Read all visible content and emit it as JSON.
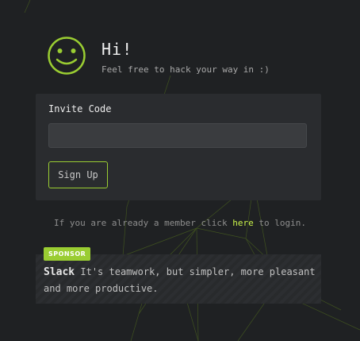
{
  "header": {
    "greeting": "Hi!",
    "tagline": "Feel free to hack your way in :)"
  },
  "form": {
    "invite_label": "Invite Code",
    "invite_value": "",
    "invite_placeholder": "",
    "signup_label": "Sign Up"
  },
  "login": {
    "prefix": "If you are already a member click",
    "link_text": "here",
    "suffix": "to login."
  },
  "sponsor": {
    "badge": "SPONSOR",
    "name": "Slack",
    "description": "It's teamwork, but simpler, more pleasant and more productive."
  },
  "colors": {
    "background": "#1f2123",
    "accent": "#9acd32",
    "link": "#c9f24a",
    "card": "#2a2c2f"
  },
  "icons": {
    "logo": "smiley-face-icon"
  }
}
